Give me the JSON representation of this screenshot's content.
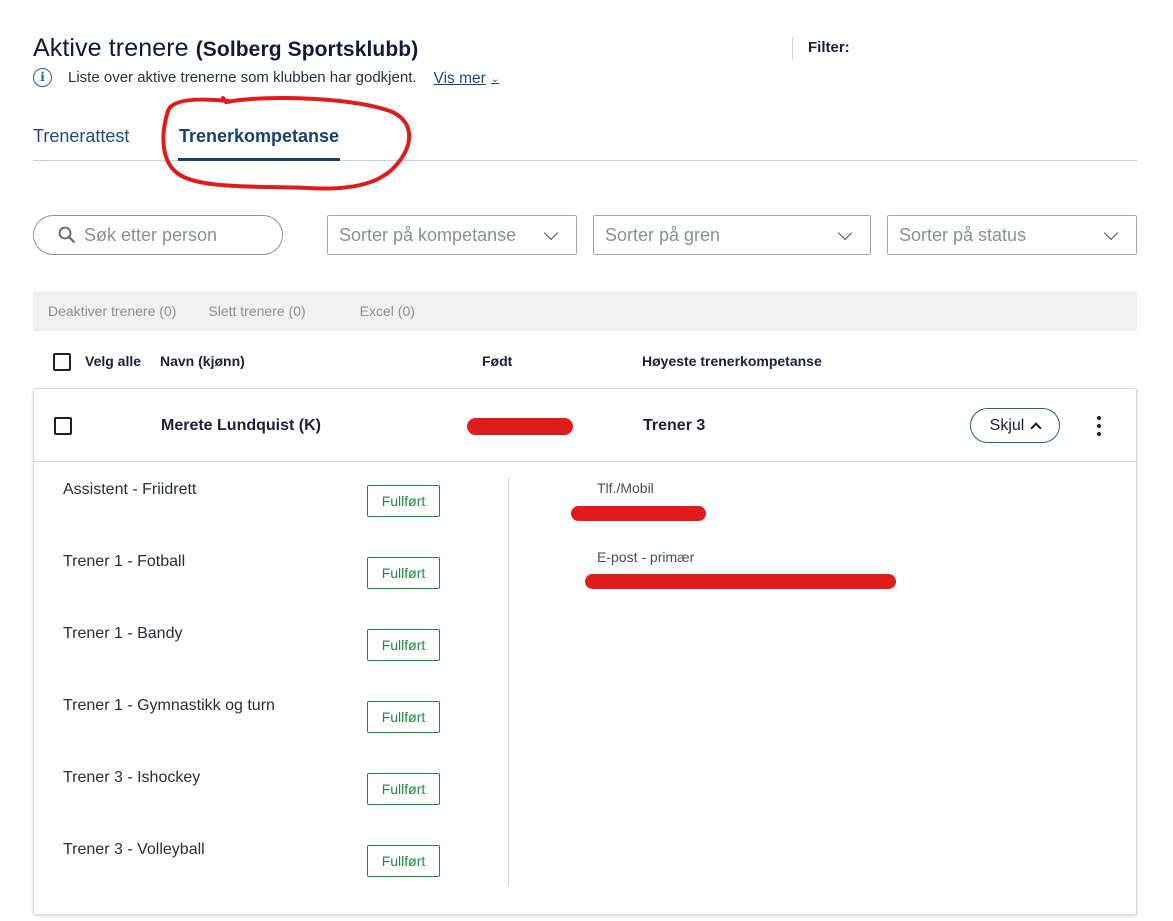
{
  "header": {
    "title": "Aktive trenere",
    "club": "(Solberg Sportsklubb)",
    "info_text": "Liste over aktive trenerne som klubben har godkjent.",
    "vis_mer": "Vis mer",
    "filter_label": "Filter:"
  },
  "tabs": [
    {
      "label": "Trenerattest",
      "active": false
    },
    {
      "label": "Trenerkompetanse",
      "active": true
    }
  ],
  "controls": {
    "search_placeholder": "Søk etter person",
    "sort_kompetanse": "Sorter på kompetanse",
    "sort_gren": "Sorter på gren",
    "sort_status": "Sorter på status"
  },
  "actions": {
    "deaktiver": "Deaktiver trenere (0)",
    "slett": "Slett trenere (0)",
    "excel": "Excel (0)"
  },
  "columns": {
    "velg_alle": "Velg alle",
    "navn": "Navn (kjønn)",
    "fodt": "Født",
    "hoyeste": "Høyeste trenerkompetanse"
  },
  "coach": {
    "name": "Merete Lundquist (K)",
    "highest_level": "Trener 3",
    "toggle_label": "Skjul",
    "competences": [
      {
        "label": "Assistent - Friidrett",
        "status": "Fullført"
      },
      {
        "label": "Trener 1 - Fotball",
        "status": "Fullført"
      },
      {
        "label": "Trener 1 - Bandy",
        "status": "Fullført"
      },
      {
        "label": "Trener 1 - Gymnastikk og turn",
        "status": "Fullført"
      },
      {
        "label": "Trener 3 - Ishockey",
        "status": "Fullført"
      },
      {
        "label": "Trener 3 - Volleyball",
        "status": "Fullført"
      }
    ],
    "contact": {
      "phone_label": "Tlf./Mobil",
      "email_label": "E-post - primær"
    }
  },
  "colors": {
    "primary_dark": "#17426f",
    "success": "#1d8a3c",
    "redaction": "#e01b1b",
    "annotation": "#e01b1b"
  }
}
